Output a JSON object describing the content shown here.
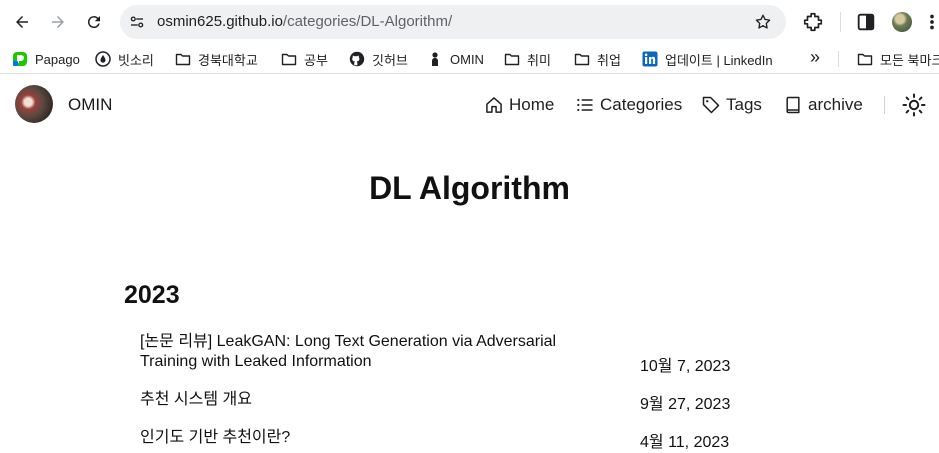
{
  "browser": {
    "url_host": "osmin625.github.io",
    "url_path": "/categories/DL-Algorithm/",
    "bookmarks": [
      {
        "label": "Papago",
        "icon": "papago-icon"
      },
      {
        "label": "빗소리",
        "icon": "rain-icon"
      },
      {
        "label": "경북대학교",
        "icon": "folder-icon"
      },
      {
        "label": "공부",
        "icon": "folder-icon"
      },
      {
        "label": "깃허브",
        "icon": "github-icon"
      },
      {
        "label": "OMIN",
        "icon": "person-icon"
      },
      {
        "label": "취미",
        "icon": "folder-icon"
      },
      {
        "label": "취업",
        "icon": "folder-icon"
      },
      {
        "label": "업데이트 | LinkedIn",
        "icon": "linkedin-icon"
      }
    ],
    "overflow_label": "»",
    "all_bookmarks_label": "모든 북마크"
  },
  "site": {
    "name": "OMIN",
    "menu": [
      {
        "label": "Home",
        "icon": "home-icon"
      },
      {
        "label": "Categories",
        "icon": "list-icon"
      },
      {
        "label": "Tags",
        "icon": "tag-icon"
      },
      {
        "label": "archive",
        "icon": "book-icon"
      }
    ]
  },
  "page": {
    "title": "DL Algorithm",
    "year": "2023",
    "posts": [
      {
        "title_line1": "[논문 리뷰] LeakGAN: Long Text Generation via Adversarial",
        "title_line2": "Training with Leaked Information",
        "date": "10월 7, 2023"
      },
      {
        "title_line1": "추천 시스템 개요",
        "title_line2": "",
        "date": "9월 27, 2023"
      },
      {
        "title_line1": "인기도 기반 추천이란?",
        "title_line2": "",
        "date": "4월 11, 2023"
      }
    ]
  },
  "colors": {
    "omnibox_bg": "#eef0f2",
    "linkedin_blue": "#0a66c2"
  }
}
